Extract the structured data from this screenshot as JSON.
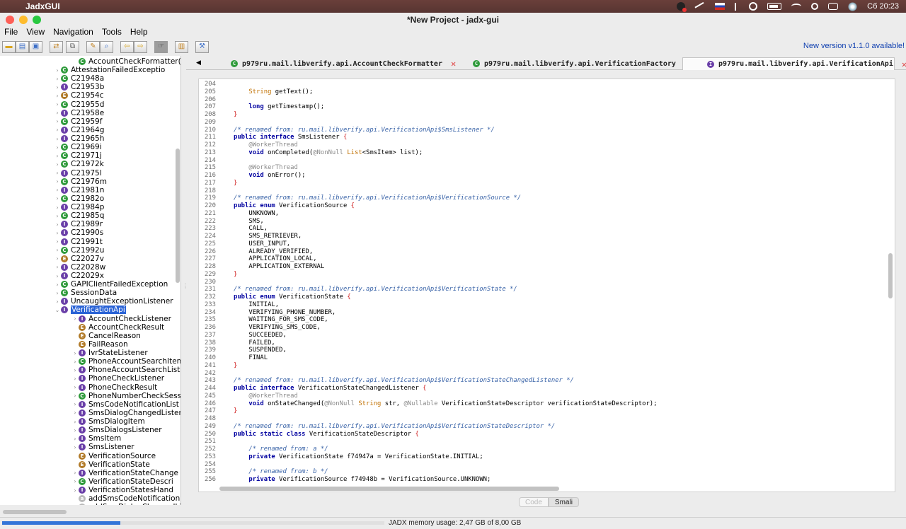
{
  "macos": {
    "apple_glyph": "",
    "app_name": "JadxGUI",
    "clock": "Сб 20:23"
  },
  "window": {
    "title": "*New Project - jadx-gui"
  },
  "menu": {
    "items": [
      "File",
      "View",
      "Navigation",
      "Tools",
      "Help"
    ]
  },
  "toolbar": {
    "new_version": "New version v1.1.0 available!"
  },
  "tree": {
    "rows": [
      {
        "label": "AccountCheckFormatter(A",
        "icon": "class",
        "glyph": "C",
        "indent": 1,
        "chev": ""
      },
      {
        "label": "AttestationFailedExceptio",
        "icon": "class",
        "glyph": "C",
        "indent": 0,
        "chev": "›"
      },
      {
        "label": "C21948a",
        "icon": "class",
        "glyph": "C",
        "indent": 0,
        "chev": "›"
      },
      {
        "label": "C21953b",
        "icon": "interface",
        "glyph": "I",
        "indent": 0,
        "chev": "›"
      },
      {
        "label": "C21954c",
        "icon": "enum",
        "glyph": "E",
        "indent": 0,
        "chev": "›"
      },
      {
        "label": "C21955d",
        "icon": "class",
        "glyph": "C",
        "indent": 0,
        "chev": "›"
      },
      {
        "label": "C21958e",
        "icon": "interface",
        "glyph": "I",
        "indent": 0,
        "chev": "›"
      },
      {
        "label": "C21959f",
        "icon": "class",
        "glyph": "C",
        "indent": 0,
        "chev": "›"
      },
      {
        "label": "C21964g",
        "icon": "interface",
        "glyph": "I",
        "indent": 0,
        "chev": "›"
      },
      {
        "label": "C21965h",
        "icon": "interface",
        "glyph": "I",
        "indent": 0,
        "chev": "›"
      },
      {
        "label": "C21969i",
        "icon": "class",
        "glyph": "C",
        "indent": 0,
        "chev": "›"
      },
      {
        "label": "C21971j",
        "icon": "class",
        "glyph": "C",
        "indent": 0,
        "chev": "›"
      },
      {
        "label": "C21972k",
        "icon": "class",
        "glyph": "C",
        "indent": 0,
        "chev": "›"
      },
      {
        "label": "C21975l",
        "icon": "interface",
        "glyph": "I",
        "indent": 0,
        "chev": "›"
      },
      {
        "label": "C21976m",
        "icon": "class",
        "glyph": "C",
        "indent": 0,
        "chev": "›"
      },
      {
        "label": "C21981n",
        "icon": "interface",
        "glyph": "I",
        "indent": 0,
        "chev": "›"
      },
      {
        "label": "C21982o",
        "icon": "class",
        "glyph": "C",
        "indent": 0,
        "chev": "›"
      },
      {
        "label": "C21984p",
        "icon": "interface",
        "glyph": "I",
        "indent": 0,
        "chev": "›"
      },
      {
        "label": "C21985q",
        "icon": "class",
        "glyph": "C",
        "indent": 0,
        "chev": "›"
      },
      {
        "label": "C21989r",
        "icon": "interface",
        "glyph": "I",
        "indent": 0,
        "chev": "›"
      },
      {
        "label": "C21990s",
        "icon": "interface",
        "glyph": "I",
        "indent": 0,
        "chev": "›"
      },
      {
        "label": "C21991t",
        "icon": "interface",
        "glyph": "I",
        "indent": 0,
        "chev": "›"
      },
      {
        "label": "C21992u",
        "icon": "class",
        "glyph": "C",
        "indent": 0,
        "chev": "›"
      },
      {
        "label": "C22027v",
        "icon": "enum",
        "glyph": "E",
        "indent": 0,
        "chev": "›"
      },
      {
        "label": "C22028w",
        "icon": "interface",
        "glyph": "I",
        "indent": 0,
        "chev": "›"
      },
      {
        "label": "C22029x",
        "icon": "interface",
        "glyph": "I",
        "indent": 0,
        "chev": "›"
      },
      {
        "label": "GAPIClientFailedException",
        "icon": "class",
        "glyph": "C",
        "indent": 0,
        "chev": "›"
      },
      {
        "label": "SessionData",
        "icon": "class",
        "glyph": "C",
        "indent": 0,
        "chev": "›"
      },
      {
        "label": "UncaughtExceptionListener",
        "icon": "interface",
        "glyph": "I",
        "indent": 0,
        "chev": "›"
      },
      {
        "label": "VerificationApi",
        "icon": "interface",
        "glyph": "I",
        "indent": 0,
        "chev": "⌄",
        "selected": true
      },
      {
        "label": "AccountCheckListener",
        "icon": "interface",
        "glyph": "I",
        "indent": 1,
        "chev": "›"
      },
      {
        "label": "AccountCheckResult",
        "icon": "enum",
        "glyph": "E",
        "indent": 1,
        "chev": ""
      },
      {
        "label": "CancelReason",
        "icon": "enum",
        "glyph": "E",
        "indent": 1,
        "chev": ""
      },
      {
        "label": "FailReason",
        "icon": "enum",
        "glyph": "E",
        "indent": 1,
        "chev": ""
      },
      {
        "label": "IvrStateListener",
        "icon": "interface",
        "glyph": "I",
        "indent": 1,
        "chev": "›"
      },
      {
        "label": "PhoneAccountSearchItem",
        "icon": "class",
        "glyph": "C",
        "indent": 1,
        "chev": "›"
      },
      {
        "label": "PhoneAccountSearchListe",
        "icon": "interface",
        "glyph": "I",
        "indent": 1,
        "chev": "›"
      },
      {
        "label": "PhoneCheckListener",
        "icon": "interface",
        "glyph": "I",
        "indent": 1,
        "chev": "›"
      },
      {
        "label": "PhoneCheckResult",
        "icon": "interface",
        "glyph": "I",
        "indent": 1,
        "chev": "›"
      },
      {
        "label": "PhoneNumberCheckSessio",
        "icon": "class",
        "glyph": "C",
        "indent": 1,
        "chev": "›"
      },
      {
        "label": "SmsCodeNotificationList",
        "icon": "interface",
        "glyph": "I",
        "indent": 1,
        "chev": "›"
      },
      {
        "label": "SmsDialogChangedListene",
        "icon": "interface",
        "glyph": "I",
        "indent": 1,
        "chev": "›"
      },
      {
        "label": "SmsDialogItem",
        "icon": "interface",
        "glyph": "I",
        "indent": 1,
        "chev": "›"
      },
      {
        "label": "SmsDialogsListener",
        "icon": "interface",
        "glyph": "I",
        "indent": 1,
        "chev": "›"
      },
      {
        "label": "SmsItem",
        "icon": "interface",
        "glyph": "I",
        "indent": 1,
        "chev": "›"
      },
      {
        "label": "SmsListener",
        "icon": "interface",
        "glyph": "I",
        "indent": 1,
        "chev": "›"
      },
      {
        "label": "VerificationSource",
        "icon": "enum",
        "glyph": "E",
        "indent": 1,
        "chev": ""
      },
      {
        "label": "VerificationState",
        "icon": "enum",
        "glyph": "E",
        "indent": 1,
        "chev": ""
      },
      {
        "label": "VerificationStateChange",
        "icon": "interface",
        "glyph": "I",
        "indent": 1,
        "chev": "›"
      },
      {
        "label": "VerificationStateDescri",
        "icon": "class",
        "glyph": "C",
        "indent": 1,
        "chev": "›"
      },
      {
        "label": "VerificationStatesHand",
        "icon": "interface",
        "glyph": "I",
        "indent": 1,
        "chev": "›"
      },
      {
        "label": "addSmsCodeNotificationL",
        "icon": "method",
        "glyph": "a",
        "indent": 1,
        "chev": ""
      },
      {
        "label": "addSmsDialogChangedLis",
        "icon": "method",
        "glyph": "a",
        "indent": 1,
        "chev": ""
      }
    ]
  },
  "tabs": [
    {
      "label": "p979ru.mail.libverify.api.AccountCheckFormatter",
      "icon": "class",
      "glyph": "C",
      "selected": false
    },
    {
      "label": "p979ru.mail.libverify.api.VerificationFactory",
      "icon": "class",
      "glyph": "C",
      "selected": false
    },
    {
      "label": "p979ru.mail.libverify.api.VerificationApi",
      "icon": "interface",
      "glyph": "I",
      "selected": true
    }
  ],
  "code": {
    "lines": [
      {
        "n": "204",
        "t": ""
      },
      {
        "n": "205",
        "t": "    <span class='ty'>String</span> getText();"
      },
      {
        "n": "206",
        "t": ""
      },
      {
        "n": "207",
        "t": "    <span class='kw'>long</span> getTimestamp();"
      },
      {
        "n": "208",
        "t": "<span class='br'>}</span>"
      },
      {
        "n": "209",
        "t": ""
      },
      {
        "n": "210",
        "t": "<span class='cm'>/* renamed from: ru.mail.libverify.api.VerificationApi$SmsListener */</span>"
      },
      {
        "n": "211",
        "t": "<span class='kw'>public interface</span> SmsListener <span class='br'>{</span>"
      },
      {
        "n": "212",
        "t": "    <span class='an'>@WorkerThread</span>"
      },
      {
        "n": "213",
        "t": "    <span class='kw'>void</span> onCompleted(<span class='an'>@NonNull</span> <span class='ty'>List</span>&lt;SmsItem&gt; list);"
      },
      {
        "n": "214",
        "t": ""
      },
      {
        "n": "215",
        "t": "    <span class='an'>@WorkerThread</span>"
      },
      {
        "n": "216",
        "t": "    <span class='kw'>void</span> onError();"
      },
      {
        "n": "217",
        "t": "<span class='br'>}</span>"
      },
      {
        "n": "218",
        "t": ""
      },
      {
        "n": "219",
        "t": "<span class='cm'>/* renamed from: ru.mail.libverify.api.VerificationApi$VerificationSource */</span>"
      },
      {
        "n": "220",
        "t": "<span class='kw'>public enum</span> VerificationSource <span class='br'>{</span>"
      },
      {
        "n": "221",
        "t": "    UNKNOWN,"
      },
      {
        "n": "222",
        "t": "    SMS,"
      },
      {
        "n": "223",
        "t": "    CALL,"
      },
      {
        "n": "224",
        "t": "    SMS_RETRIEVER,"
      },
      {
        "n": "225",
        "t": "    USER_INPUT,"
      },
      {
        "n": "226",
        "t": "    ALREADY_VERIFIED,"
      },
      {
        "n": "227",
        "t": "    APPLICATION_LOCAL,"
      },
      {
        "n": "228",
        "t": "    APPLICATION_EXTERNAL"
      },
      {
        "n": "229",
        "t": "<span class='br'>}</span>"
      },
      {
        "n": "230",
        "t": ""
      },
      {
        "n": "231",
        "t": "<span class='cm'>/* renamed from: ru.mail.libverify.api.VerificationApi$VerificationState */</span>"
      },
      {
        "n": "232",
        "t": "<span class='kw'>public enum</span> VerificationState <span class='br'>{</span>"
      },
      {
        "n": "233",
        "t": "    INITIAL,"
      },
      {
        "n": "234",
        "t": "    VERIFYING_PHONE_NUMBER,"
      },
      {
        "n": "235",
        "t": "    WAITING_FOR_SMS_CODE,"
      },
      {
        "n": "236",
        "t": "    VERIFYING_SMS_CODE,"
      },
      {
        "n": "237",
        "t": "    SUCCEEDED,"
      },
      {
        "n": "238",
        "t": "    FAILED,"
      },
      {
        "n": "239",
        "t": "    SUSPENDED,"
      },
      {
        "n": "240",
        "t": "    FINAL"
      },
      {
        "n": "241",
        "t": "<span class='br'>}</span>"
      },
      {
        "n": "242",
        "t": ""
      },
      {
        "n": "243",
        "t": "<span class='cm'>/* renamed from: ru.mail.libverify.api.VerificationApi$VerificationStateChangedListener */</span>"
      },
      {
        "n": "244",
        "t": "<span class='kw'>public interface</span> VerificationStateChangedListener <span class='br'>{</span>"
      },
      {
        "n": "245",
        "t": "    <span class='an'>@WorkerThread</span>"
      },
      {
        "n": "246",
        "t": "    <span class='kw'>void</span> onStateChanged(<span class='an'>@NonNull</span> <span class='ty'>String</span> str, <span class='an'>@Nullable</span> VerificationStateDescriptor verificationStateDescriptor);"
      },
      {
        "n": "247",
        "t": "<span class='br'>}</span>"
      },
      {
        "n": "248",
        "t": ""
      },
      {
        "n": "249",
        "t": "<span class='cm'>/* renamed from: ru.mail.libverify.api.VerificationApi$VerificationStateDescriptor */</span>"
      },
      {
        "n": "250",
        "t": "<span class='kw'>public static class</span> VerificationStateDescriptor <span class='br'>{</span>"
      },
      {
        "n": "251",
        "t": ""
      },
      {
        "n": "252",
        "t": "    <span class='cm'>/* renamed from: a */</span>"
      },
      {
        "n": "253",
        "t": "    <span class='kw'>private</span> VerificationState f74947a = VerificationState.INITIAL;"
      },
      {
        "n": "254",
        "t": ""
      },
      {
        "n": "255",
        "t": "    <span class='cm'>/* renamed from: b */</span>"
      },
      {
        "n": "256",
        "t": "    <span class='kw'>private</span> VerificationSource f74948b = VerificationSource.UNKNOWN;"
      }
    ]
  },
  "view_toggle": {
    "code": "Code",
    "smali": "Smali"
  },
  "status": {
    "memory": "JADX memory usage: 2,47 GB of 8,00 GB",
    "memory_fraction": 0.30875
  }
}
